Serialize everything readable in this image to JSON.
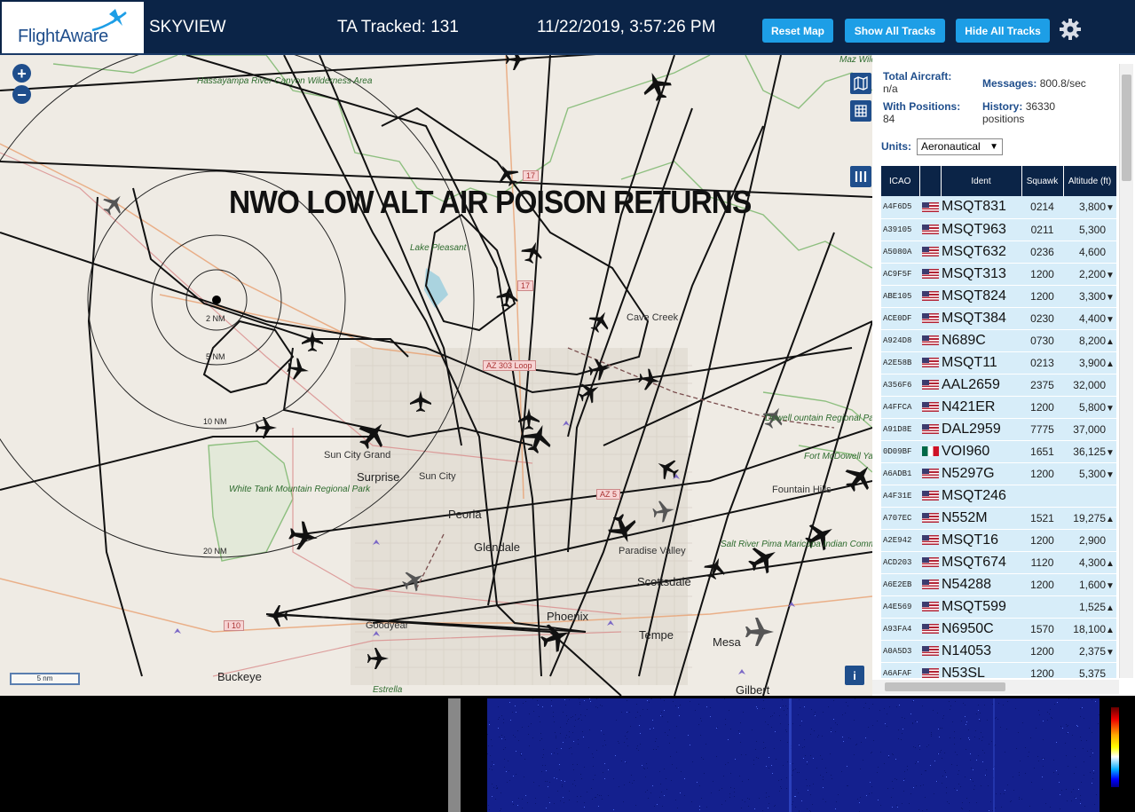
{
  "header": {
    "logo_text": "FlightAware",
    "app_name": "SKYVIEW",
    "ta_tracked": "TA Tracked: 131",
    "datetime": "11/22/2019, 3:57:26 PM",
    "buttons": {
      "reset_map": "Reset Map",
      "show_all": "Show All Tracks",
      "hide_all": "Hide All Tracks"
    },
    "settings_icon": "gear-icon"
  },
  "map": {
    "headline": "NWO LOW ALT AIR POISON RETURNS",
    "zoom_in": "+",
    "zoom_out": "−",
    "scale": "5 nm",
    "info": "i",
    "ring_labels": [
      "2 NM",
      "5 NM",
      "10 NM",
      "20 NM"
    ],
    "places": {
      "hassayampa": "Hassayampa River Canyon Wilderness Area",
      "cave_creek": "Cave Creek",
      "sun_city_grand": "Sun City Grand",
      "surprise": "Surprise",
      "sun_city": "Sun City",
      "peoria": "Peoria",
      "glendale": "Glendale",
      "paradise_valley": "Paradise Valley",
      "scottsdale": "Scottsdale",
      "phoenix": "Phoenix",
      "tempe": "Tempe",
      "mesa": "Mesa",
      "goodyear": "Goodyear",
      "buckeye": "Buckeye",
      "gilbert": "Gilbert",
      "estrella": "Estrella",
      "white_tank": "White Tank Mountain Regional Park",
      "mcdowell": "Dowell ountain Regional Park",
      "fort_mcdowell": "Fort McDowell Yavapai Nation",
      "fountain_hills": "Fountain Hills",
      "salt_river": "Salt River Pima Maricopa Indian Community",
      "lake_pleasant": "Lake Pleasant",
      "wild": "Maz Wild"
    },
    "shields": {
      "i17_a": "17",
      "i17_b": "17",
      "az303": "AZ 303 Loop",
      "az51": "AZ 5",
      "i10": "I 10"
    }
  },
  "sidebar": {
    "total_aircraft_label": "Total Aircraft:",
    "total_aircraft_value": "n/a",
    "with_positions_label": "With Positions:",
    "with_positions_value": "84",
    "messages_label": "Messages:",
    "messages_value": "800.8/sec",
    "history_label": "History:",
    "history_value": "36330",
    "history_unit": "positions",
    "units_label": "Units:",
    "units_value": "Aeronautical",
    "columns": [
      "ICAO",
      "",
      "Ident",
      "Squawk",
      "Altitude (ft)"
    ],
    "rows": [
      {
        "icao": "A4F6D5",
        "flag": "us",
        "ident": "MSQT831",
        "squawk": "0214",
        "alt": "3,800",
        "trend": "▼"
      },
      {
        "icao": "A39105",
        "flag": "us",
        "ident": "MSQT963",
        "squawk": "0211",
        "alt": "5,300",
        "trend": ""
      },
      {
        "icao": "A5080A",
        "flag": "us",
        "ident": "MSQT632",
        "squawk": "0236",
        "alt": "4,600",
        "trend": ""
      },
      {
        "icao": "AC9F5F",
        "flag": "us",
        "ident": "MSQT313",
        "squawk": "1200",
        "alt": "2,200",
        "trend": "▼"
      },
      {
        "icao": "ABE105",
        "flag": "us",
        "ident": "MSQT824",
        "squawk": "1200",
        "alt": "3,300",
        "trend": "▼"
      },
      {
        "icao": "ACE0DF",
        "flag": "us",
        "ident": "MSQT384",
        "squawk": "0230",
        "alt": "4,400",
        "trend": "▼"
      },
      {
        "icao": "A924D8",
        "flag": "us",
        "ident": "N689C",
        "squawk": "0730",
        "alt": "8,200",
        "trend": "▲"
      },
      {
        "icao": "A2E58B",
        "flag": "us",
        "ident": "MSQT11",
        "squawk": "0213",
        "alt": "3,900",
        "trend": "▲"
      },
      {
        "icao": "A356F6",
        "flag": "us",
        "ident": "AAL2659",
        "squawk": "2375",
        "alt": "32,000",
        "trend": ""
      },
      {
        "icao": "A4FFCA",
        "flag": "us",
        "ident": "N421ER",
        "squawk": "1200",
        "alt": "5,800",
        "trend": "▼"
      },
      {
        "icao": "A91D8E",
        "flag": "us",
        "ident": "DAL2959",
        "squawk": "7775",
        "alt": "37,000",
        "trend": ""
      },
      {
        "icao": "0D09BF",
        "flag": "mx",
        "ident": "VOI960",
        "squawk": "1651",
        "alt": "36,125",
        "trend": "▼"
      },
      {
        "icao": "A6ADB1",
        "flag": "us",
        "ident": "N5297G",
        "squawk": "1200",
        "alt": "5,300",
        "trend": "▼"
      },
      {
        "icao": "A4F31E",
        "flag": "us",
        "ident": "MSQT246",
        "squawk": "",
        "alt": "",
        "trend": ""
      },
      {
        "icao": "A707EC",
        "flag": "us",
        "ident": "N552M",
        "squawk": "1521",
        "alt": "19,275",
        "trend": "▲"
      },
      {
        "icao": "A2E942",
        "flag": "us",
        "ident": "MSQT16",
        "squawk": "1200",
        "alt": "2,900",
        "trend": ""
      },
      {
        "icao": "ACD203",
        "flag": "us",
        "ident": "MSQT674",
        "squawk": "1120",
        "alt": "4,300",
        "trend": "▲"
      },
      {
        "icao": "A6E2EB",
        "flag": "us",
        "ident": "N54288",
        "squawk": "1200",
        "alt": "1,600",
        "trend": "▼"
      },
      {
        "icao": "A4E569",
        "flag": "us",
        "ident": "MSQT599",
        "squawk": "",
        "alt": "1,525",
        "trend": "▲"
      },
      {
        "icao": "A93FA4",
        "flag": "us",
        "ident": "N6950C",
        "squawk": "1570",
        "alt": "18,100",
        "trend": "▲"
      },
      {
        "icao": "A0A5D3",
        "flag": "us",
        "ident": "N14053",
        "squawk": "1200",
        "alt": "2,375",
        "trend": "▼"
      },
      {
        "icao": "A6AFAF",
        "flag": "us",
        "ident": "N53SL",
        "squawk": "1200",
        "alt": "5,375",
        "trend": ""
      }
    ]
  },
  "colors": {
    "header_bg": "#0b2447",
    "button": "#1d9ee6",
    "row_bg": "#d7edf9",
    "accent": "#1f4e8c"
  }
}
